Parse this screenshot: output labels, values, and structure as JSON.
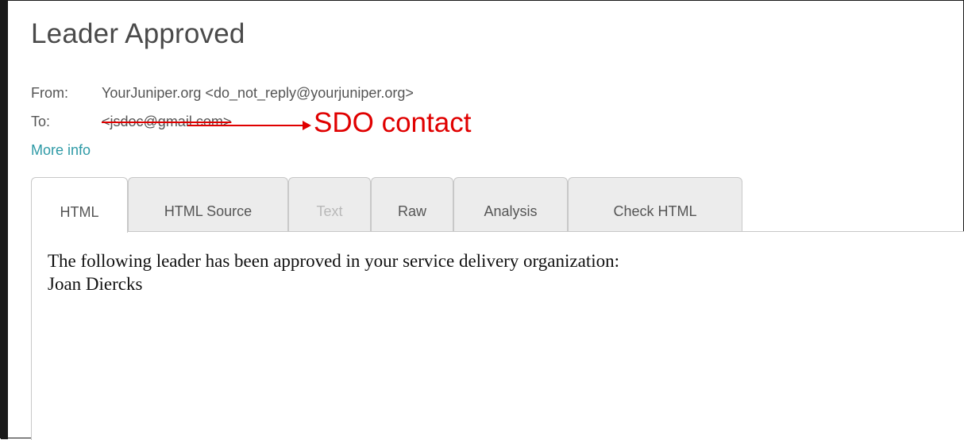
{
  "email": {
    "title": "Leader Approved",
    "from_label": "From:",
    "from_value": "YourJuniper.org <do_not_reply@yourjuniper.org>",
    "to_label": "To:",
    "to_value": "<jsdoc@gmail.com>",
    "more_info": "More info",
    "body_line1": "The following leader has been approved in your service delivery organization:",
    "body_line2": "Joan Diercks"
  },
  "annotation": {
    "text": "SDO contact",
    "color": "#e00000"
  },
  "tabs": [
    {
      "label": "HTML",
      "active": true
    },
    {
      "label": "HTML Source"
    },
    {
      "label": "Text",
      "disabled": true
    },
    {
      "label": "Raw"
    },
    {
      "label": "Analysis"
    },
    {
      "label": "Check HTML"
    }
  ]
}
